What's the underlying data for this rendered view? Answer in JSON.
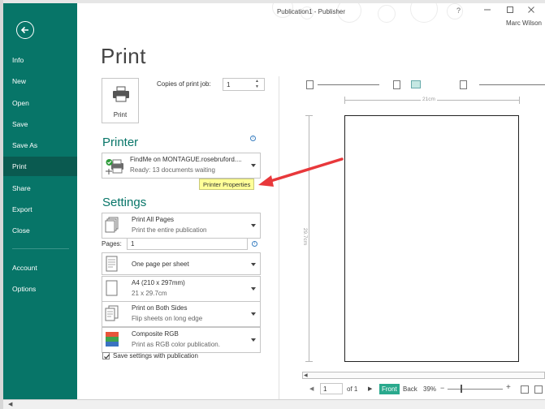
{
  "window": {
    "title": "Publication1 - Publisher",
    "help_label": "?",
    "user_name": "Marc Wilson"
  },
  "sidebar": {
    "items": [
      {
        "label": "Info"
      },
      {
        "label": "New"
      },
      {
        "label": "Open"
      },
      {
        "label": "Save"
      },
      {
        "label": "Save As"
      },
      {
        "label": "Print"
      },
      {
        "label": "Share"
      },
      {
        "label": "Export"
      },
      {
        "label": "Close"
      },
      {
        "label": "Account"
      },
      {
        "label": "Options"
      }
    ],
    "active": "Print",
    "background_color": "#077568"
  },
  "print": {
    "page_title": "Print",
    "print_button_label": "Print",
    "copies_label": "Copies of print job:",
    "copies_value": "1"
  },
  "printer": {
    "heading": "Printer",
    "name": "FindMe on MONTAGUE.rosebruford....",
    "status": "Ready: 13 documents waiting",
    "properties_label": "Printer Properties"
  },
  "settings": {
    "heading": "Settings",
    "pages_label": "Pages:",
    "pages_value": "1",
    "options": [
      {
        "title": "Print All Pages",
        "subtitle": "Print the entire publication",
        "icon": "pages-icon"
      },
      {
        "title": "One page per sheet",
        "subtitle": "",
        "icon": "sheet-icon"
      },
      {
        "title": "A4 (210 x 297mm)",
        "subtitle": "21 x 29.7cm",
        "icon": "paper-size-icon"
      },
      {
        "title": "Print on Both Sides",
        "subtitle": "Flip sheets on long edge",
        "icon": "duplex-icon"
      },
      {
        "title": "Composite RGB",
        "subtitle": "Print as RGB color publication.",
        "icon": "color-icon"
      }
    ],
    "save_settings_label": "Save settings with publication",
    "save_settings_checked": true
  },
  "preview": {
    "width_label": "21cm",
    "height_label": "29.7cm",
    "page_number": "1",
    "page_count_label": "of 1",
    "front_label": "Front",
    "back_label": "Back",
    "zoom_label": "39%"
  },
  "colors": {
    "accent": "#077568",
    "annotation_arrow": "#e8383b",
    "tooltip_bg": "#ffff98",
    "front_active": "#2aa98d"
  }
}
